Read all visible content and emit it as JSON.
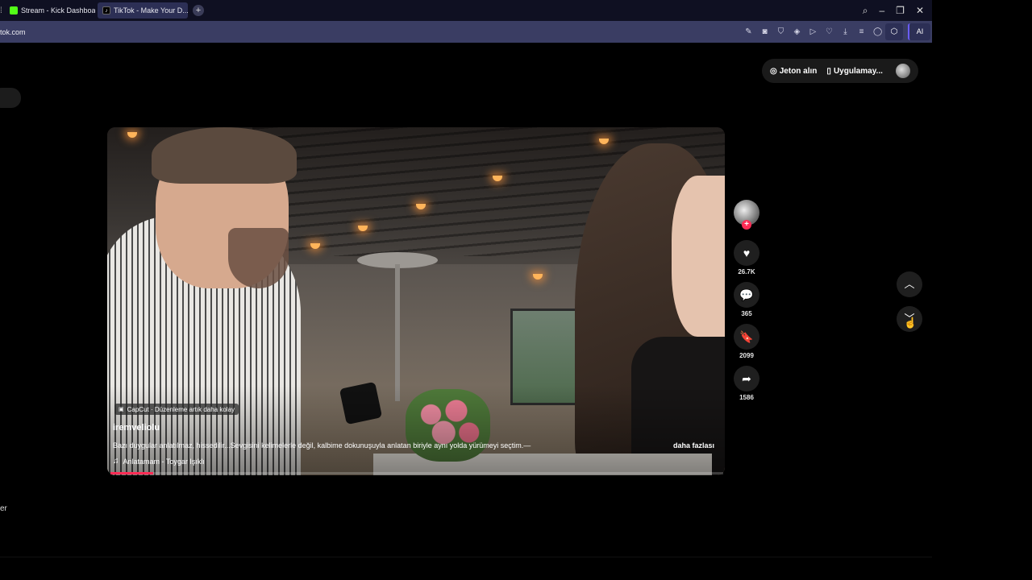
{
  "browser": {
    "tabs": [
      {
        "label": "Stream - Kick Dashboard",
        "active": false
      },
      {
        "label": "TikTok - Make Your D...",
        "active": true
      }
    ],
    "new_tab": "+",
    "url": "tok.com",
    "ai_label": "AI"
  },
  "left_fragment": "er",
  "top_actions": {
    "coins_label": "Jeton alın",
    "app_label": "Uygulamay..."
  },
  "video": {
    "capcut_label": "CapCut · Düzenleme artık daha kolay",
    "author": "iremveliolu",
    "caption": "Bazı duygular anlatılmaz, hissedilir...Sevgisini kelimelerle değil, kalbime dokunuşuyla anlatan biriyle aynı yolda yürümeyi seçtim.—",
    "more_label": "daha fazlası",
    "music": "Anlatamam - Toygar Işıklı",
    "progress": 0.07
  },
  "actions": {
    "likes": "26.7K",
    "comments": "365",
    "saves": "2099",
    "shares": "1586"
  },
  "colors": {
    "accent": "#fe2c55",
    "tabbar": "#0f1022",
    "addrbar": "#3a3d63"
  }
}
